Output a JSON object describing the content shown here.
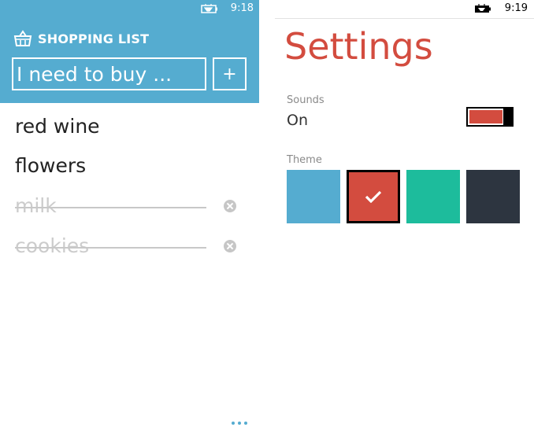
{
  "shopping_screen": {
    "status_time": "9:18",
    "app_title": "SHOPPING LIST",
    "input_placeholder": "I need to buy ...",
    "add_button_label": "+",
    "items": [
      {
        "text": "red wine",
        "done": false
      },
      {
        "text": "flowers",
        "done": false
      },
      {
        "text": "milk",
        "done": true
      },
      {
        "text": "cookies",
        "done": true
      }
    ]
  },
  "settings_screen": {
    "status_time": "9:19",
    "title": "Settings",
    "sounds_label": "Sounds",
    "sounds_value": "On",
    "sounds_enabled": true,
    "theme_label": "Theme",
    "themes": [
      {
        "color": "#55acd0",
        "selected": false
      },
      {
        "color": "#d34c3f",
        "selected": true
      },
      {
        "color": "#1dbc9c",
        "selected": false
      },
      {
        "color": "#2d3540",
        "selected": false
      }
    ]
  },
  "colors": {
    "accent_blue": "#55acd0",
    "accent_red": "#d34c3f"
  },
  "icons": {
    "status_battery": "battery-charging-icon",
    "header": "shopping-basket-icon",
    "remove": "remove-circle-icon",
    "selected_theme": "checkmark-icon",
    "app_bar": "more-dots-icon"
  }
}
